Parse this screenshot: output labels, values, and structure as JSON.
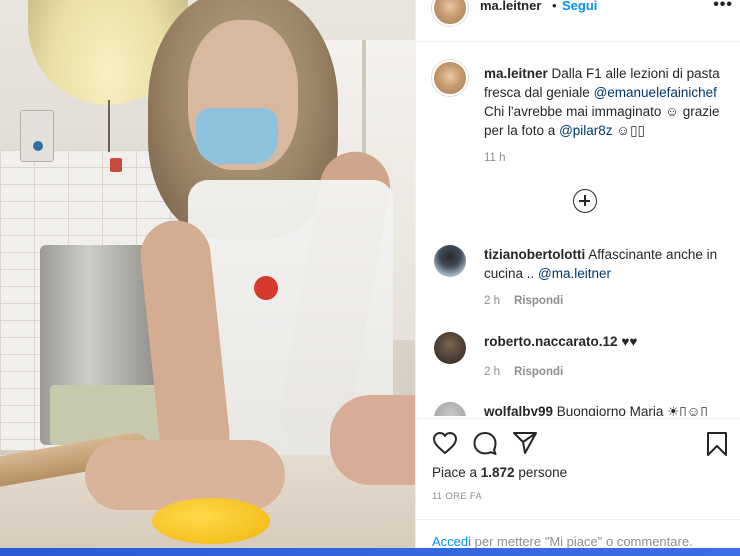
{
  "post": {
    "username": "ma.leitner",
    "separator": "•",
    "follow_label": "Segui",
    "more_icon": "more-horizontal-icon"
  },
  "caption": {
    "username": "ma.leitner",
    "text_before": " Dalla F1 alle lezioni di pasta fresca dal geniale ",
    "mention1": "@emanuelefainichef",
    "text_middle": " Chi l'avrebbe mai immaginato ☺ grazie per la foto a ",
    "mention2": "@pilar8z",
    "text_after": " ☺▯▯",
    "time": "11 h"
  },
  "comments": [
    {
      "username": "tizianobertolotti",
      "text": " Affascinante anche in cucina .. ",
      "mention": "@ma.leitner",
      "time": "2 h",
      "reply": "Rispondi"
    },
    {
      "username": "roberto.naccarato.12",
      "text": " ♥♥",
      "time": "2 h",
      "reply": "Rispondi"
    },
    {
      "username": "wolfalby99",
      "text": " Buongiorno Maria ☀▯☺▯"
    }
  ],
  "actions": {
    "likes_prefix": "Piace a ",
    "likes_count": "1.872",
    "likes_suffix": " persone",
    "date": "11 ORE FA"
  },
  "login": {
    "link": "Accedi",
    "text": " per mettere \"Mi piace\" o commentare."
  },
  "colors": {
    "link_blue": "#0095f6",
    "mention_blue": "#00376b",
    "muted_gray": "#8e8e8e"
  }
}
